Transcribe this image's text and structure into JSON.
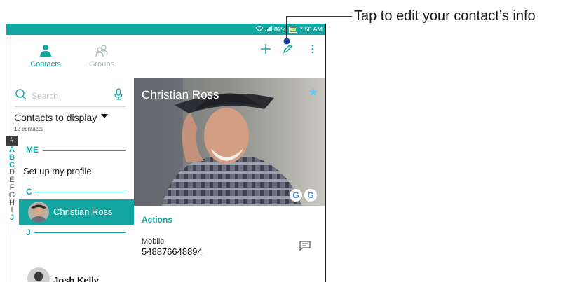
{
  "status_bar": {
    "battery": "82%",
    "time": "7:58 AM"
  },
  "tabs": [
    {
      "label": "Contacts",
      "icon": "person-icon",
      "active": true
    },
    {
      "label": "Groups",
      "icon": "group-icon",
      "active": false
    }
  ],
  "toolbar": {
    "add_icon": "plus-icon",
    "edit_icon": "pencil-icon",
    "menu_icon": "overflow-menu-icon"
  },
  "search": {
    "placeholder": "Search",
    "icon": "search-icon",
    "mic_icon": "mic-icon"
  },
  "contacts_filter": {
    "label": "Contacts to display",
    "count": "12 contacts"
  },
  "alphabet_index": [
    "#",
    "A",
    "B",
    "C",
    "D",
    "E",
    "F",
    "G",
    "H",
    "I",
    "J"
  ],
  "sections": [
    {
      "label": "ME",
      "items": [
        "Set up my profile"
      ]
    },
    {
      "label": "C",
      "items": [
        "Christian Ross"
      ]
    },
    {
      "label": "J",
      "items": [
        "Josh Kelly"
      ]
    }
  ],
  "detail": {
    "name": "Christian Ross",
    "favorite": true,
    "accounts": [
      "G",
      "G"
    ],
    "actions_heading": "Actions",
    "phone_label": "Mobile",
    "phone_number": "548876648894",
    "message_icon": "message-icon"
  },
  "callout": {
    "text": "Tap to edit your contact’s info"
  },
  "colors": {
    "accent": "#13a6a1",
    "star": "#62c6ff",
    "battery": "#b6f08a"
  }
}
